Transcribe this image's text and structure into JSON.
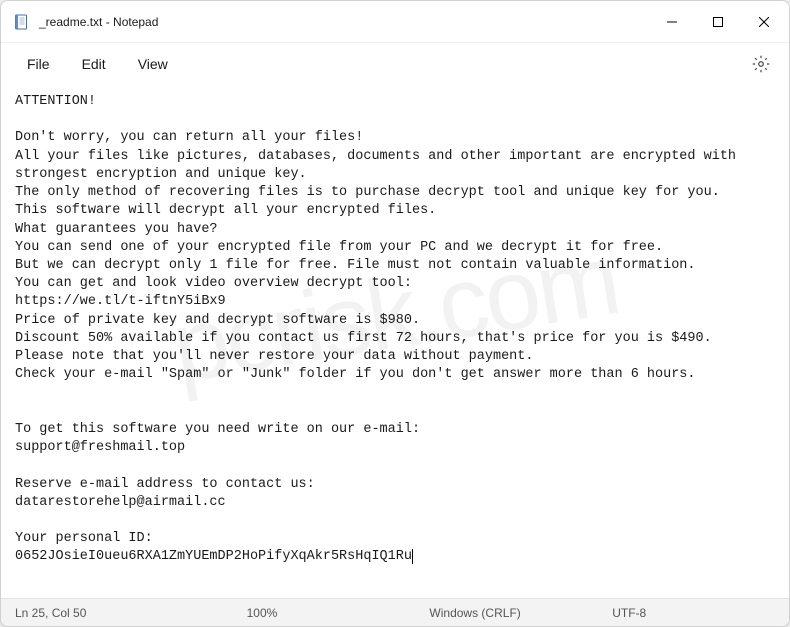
{
  "titlebar": {
    "title": "_readme.txt - Notepad"
  },
  "menu": {
    "file": "File",
    "edit": "Edit",
    "view": "View"
  },
  "content": {
    "body": "ATTENTION!\n\nDon't worry, you can return all your files!\nAll your files like pictures, databases, documents and other important are encrypted with strongest encryption and unique key.\nThe only method of recovering files is to purchase decrypt tool and unique key for you.\nThis software will decrypt all your encrypted files.\nWhat guarantees you have?\nYou can send one of your encrypted file from your PC and we decrypt it for free.\nBut we can decrypt only 1 file for free. File must not contain valuable information.\nYou can get and look video overview decrypt tool:\nhttps://we.tl/t-iftnY5iBx9\nPrice of private key and decrypt software is $980.\nDiscount 50% available if you contact us first 72 hours, that's price for you is $490.\nPlease note that you'll never restore your data without payment.\nCheck your e-mail \"Spam\" or \"Junk\" folder if you don't get answer more than 6 hours.\n\n\nTo get this software you need write on our e-mail:\nsupport@freshmail.top\n\nReserve e-mail address to contact us:\ndatarestorehelp@airmail.cc\n\nYour personal ID:\n0652JOsieI0ueu6RXA1ZmYUEmDP2HoPifyXqAkr5RsHqIQ1Ru"
  },
  "statusbar": {
    "position": "Ln 25, Col 50",
    "zoom": "100%",
    "lineending": "Windows (CRLF)",
    "encoding": "UTF-8"
  },
  "watermark": "pcrisk.com"
}
